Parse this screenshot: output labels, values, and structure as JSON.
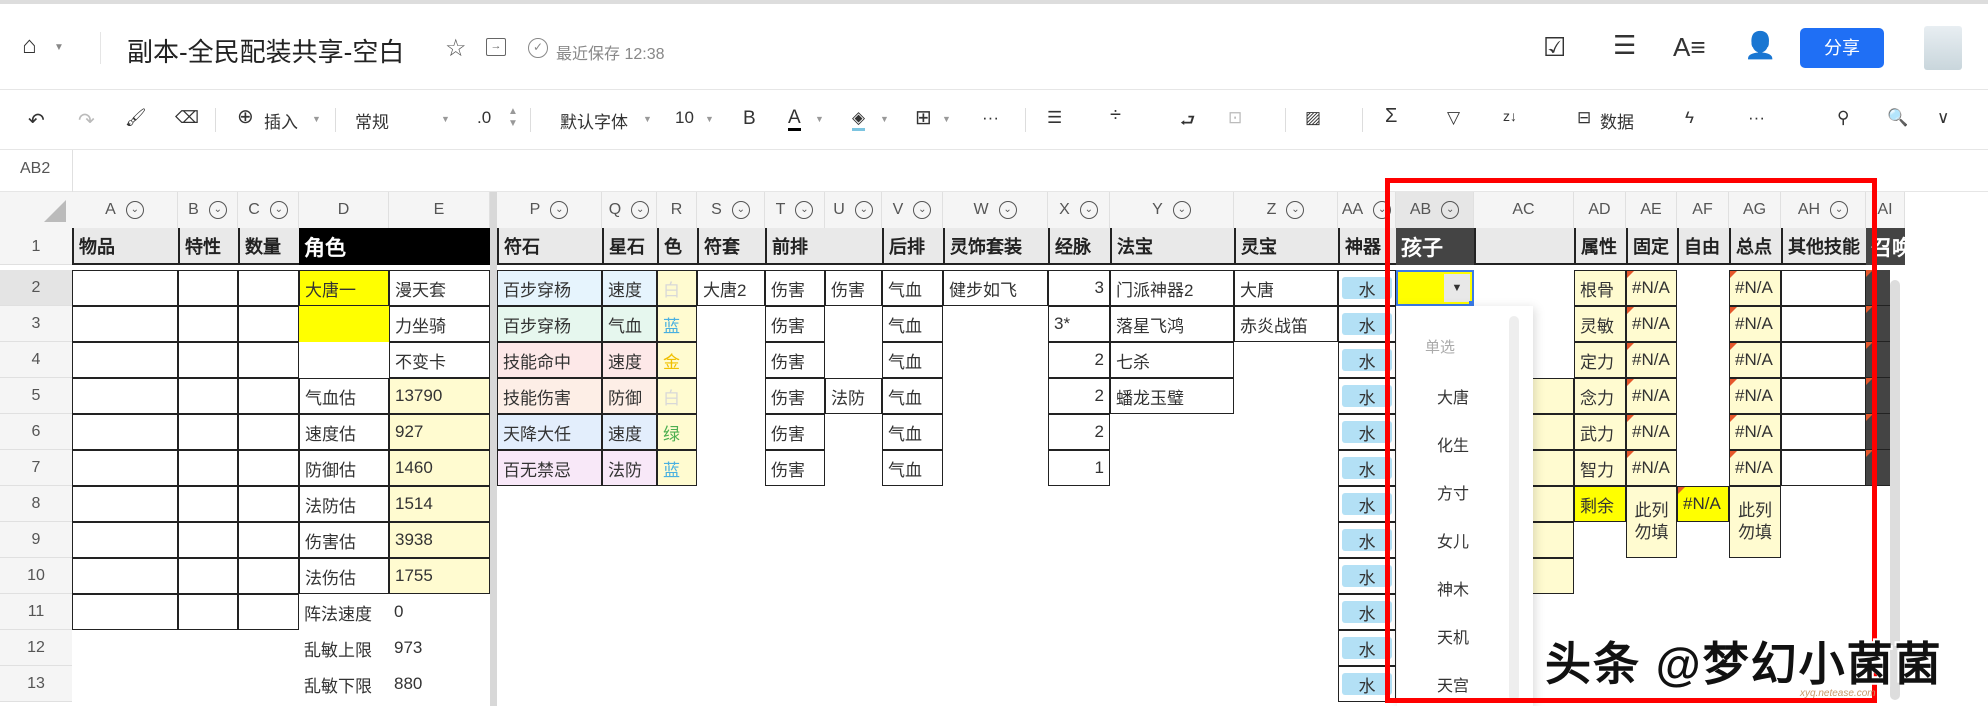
{
  "header": {
    "title": "副本-全民配装共享-空白",
    "save_status": "最近保存 12:38",
    "share": "分享"
  },
  "toolbar": {
    "insert": "插入",
    "format": "常规",
    "decimal": ".0",
    "font": "默认字体",
    "size": "10",
    "bold": "B",
    "font_color": "A",
    "data": "数据",
    "more": "···"
  },
  "formula_bar": {
    "cell_ref": "AB2"
  },
  "columns": [
    {
      "id": "A",
      "filter": true
    },
    {
      "id": "B",
      "filter": true
    },
    {
      "id": "C",
      "filter": true
    },
    {
      "id": "D"
    },
    {
      "id": "E"
    },
    {
      "id": "P",
      "filter": true
    },
    {
      "id": "Q",
      "filter": true
    },
    {
      "id": "R"
    },
    {
      "id": "S",
      "filter": true
    },
    {
      "id": "T",
      "filter": true
    },
    {
      "id": "U",
      "filter": true
    },
    {
      "id": "V",
      "filter": true
    },
    {
      "id": "W",
      "filter": true
    },
    {
      "id": "X",
      "filter": true
    },
    {
      "id": "Y",
      "filter": true
    },
    {
      "id": "Z",
      "filter": true
    },
    {
      "id": "AA",
      "filter": true
    },
    {
      "id": "AB",
      "filter": true
    },
    {
      "id": "AC"
    },
    {
      "id": "AD"
    },
    {
      "id": "AE"
    },
    {
      "id": "AF"
    },
    {
      "id": "AG"
    },
    {
      "id": "AH",
      "filter": true
    },
    {
      "id": "AI"
    }
  ],
  "rows": [
    "1",
    "2",
    "3",
    "4",
    "5",
    "6",
    "7",
    "8",
    "9",
    "10",
    "11",
    "12",
    "13"
  ],
  "colors": {
    "light_yellow": "#fffbd0",
    "yellow": "#ffff00",
    "chip": "#b3e0f5",
    "red": "#ff0000",
    "share": "#1f6ff5"
  },
  "cells": [
    {
      "c": "A",
      "r": 1,
      "t": "物品",
      "s": "hdr"
    },
    {
      "c": "B",
      "r": 1,
      "t": "特性",
      "s": "hdr"
    },
    {
      "c": "C",
      "r": 1,
      "t": "数量",
      "s": "hdr"
    },
    {
      "c": "D",
      "c2": "E",
      "r": 1,
      "t": "角色",
      "s": "hdrblack"
    },
    {
      "c": "P",
      "r": 1,
      "t": "符石",
      "s": "hdr"
    },
    {
      "c": "Q",
      "r": 1,
      "t": "星石",
      "s": "hdr"
    },
    {
      "c": "R",
      "r": 1,
      "t": "色",
      "s": "hdr"
    },
    {
      "c": "S",
      "r": 1,
      "t": "符套",
      "s": "hdr"
    },
    {
      "c": "T",
      "c2": "U",
      "r": 1,
      "t": "前排",
      "s": "hdr"
    },
    {
      "c": "V",
      "r": 1,
      "t": "后排",
      "s": "hdr"
    },
    {
      "c": "W",
      "r": 1,
      "t": "灵饰套装",
      "s": "hdr"
    },
    {
      "c": "X",
      "r": 1,
      "t": "经脉",
      "s": "hdr"
    },
    {
      "c": "Y",
      "r": 1,
      "t": "法宝",
      "s": "hdr"
    },
    {
      "c": "Z",
      "r": 1,
      "t": "灵宝",
      "s": "hdr"
    },
    {
      "c": "AA",
      "r": 1,
      "t": "神器",
      "s": "hdr"
    },
    {
      "c": "AB",
      "r": 1,
      "t": "孩子",
      "s": "hdrdark"
    },
    {
      "c": "AC",
      "r": 1,
      "t": "",
      "s": "hdr"
    },
    {
      "c": "AD",
      "r": 1,
      "t": "属性",
      "s": "hdr"
    },
    {
      "c": "AE",
      "r": 1,
      "t": "固定",
      "s": "hdr"
    },
    {
      "c": "AF",
      "r": 1,
      "t": "自由",
      "s": "hdr"
    },
    {
      "c": "AG",
      "r": 1,
      "t": "总点",
      "s": "hdr"
    },
    {
      "c": "AH",
      "r": 1,
      "t": "其他技能",
      "s": "hdr"
    },
    {
      "c": "AI",
      "r": 1,
      "t": "召唤",
      "s": "hdrdark"
    },
    {
      "c": "D",
      "r": 2,
      "t": "大唐一",
      "s": "b",
      "bg": "#ffff00"
    },
    {
      "c": "D",
      "r": 3,
      "t": "",
      "bg": "#ffff00"
    },
    {
      "c": "E",
      "r": 2,
      "t": "漫天套",
      "s": "b"
    },
    {
      "c": "E",
      "r": 3,
      "t": "力坐骑",
      "s": "b"
    },
    {
      "c": "E",
      "r": 4,
      "t": "不变卡",
      "s": "b"
    },
    {
      "c": "D",
      "r": 5,
      "t": "气血估",
      "s": "b"
    },
    {
      "c": "E",
      "r": 5,
      "t": "13790",
      "s": "b",
      "bg": "#fffbd0"
    },
    {
      "c": "D",
      "r": 6,
      "t": "速度估",
      "s": "b"
    },
    {
      "c": "E",
      "r": 6,
      "t": "927",
      "s": "b",
      "bg": "#fffbd0"
    },
    {
      "c": "D",
      "r": 7,
      "t": "防御估",
      "s": "b"
    },
    {
      "c": "E",
      "r": 7,
      "t": "1460",
      "s": "b",
      "bg": "#fffbd0"
    },
    {
      "c": "D",
      "r": 8,
      "t": "法防估",
      "s": "b"
    },
    {
      "c": "E",
      "r": 8,
      "t": "1514",
      "s": "b",
      "bg": "#fffbd0"
    },
    {
      "c": "D",
      "r": 9,
      "t": "伤害估",
      "s": "b"
    },
    {
      "c": "E",
      "r": 9,
      "t": "3938",
      "s": "b",
      "bg": "#fffbd0"
    },
    {
      "c": "D",
      "r": 10,
      "t": "法伤估",
      "s": "b"
    },
    {
      "c": "E",
      "r": 10,
      "t": "1755",
      "s": "b",
      "bg": "#fffbd0"
    },
    {
      "c": "D",
      "r": 11,
      "t": "阵法速度"
    },
    {
      "c": "E",
      "r": 11,
      "t": "0"
    },
    {
      "c": "D",
      "r": 12,
      "t": "乱敏上限"
    },
    {
      "c": "E",
      "r": 12,
      "t": "973"
    },
    {
      "c": "D",
      "r": 13,
      "t": "乱敏下限"
    },
    {
      "c": "E",
      "r": 13,
      "t": "880"
    },
    {
      "c": "P",
      "r": 2,
      "t": "百步穿杨",
      "s": "b",
      "bg": "#e6f4fd"
    },
    {
      "c": "Q",
      "r": 2,
      "t": "速度",
      "s": "b",
      "bg": "#e6f4fd"
    },
    {
      "c": "R",
      "r": 2,
      "t": "白",
      "s": "b",
      "bg": "#fffbd0",
      "fg": "#d8d8d8"
    },
    {
      "c": "P",
      "r": 3,
      "t": "百步穿杨",
      "s": "b",
      "bg": "#e6f7ee"
    },
    {
      "c": "Q",
      "r": 3,
      "t": "气血",
      "s": "b",
      "bg": "#e6f7ee"
    },
    {
      "c": "R",
      "r": 3,
      "t": "蓝",
      "s": "b",
      "bg": "#fffbd0",
      "fg": "#4ab0e0"
    },
    {
      "c": "P",
      "r": 4,
      "t": "技能命中",
      "s": "b",
      "bg": "#fde8e8"
    },
    {
      "c": "Q",
      "r": 4,
      "t": "速度",
      "s": "b",
      "bg": "#fde8e8"
    },
    {
      "c": "R",
      "r": 4,
      "t": "金",
      "s": "b",
      "bg": "#fffbd0",
      "fg": "#f0c000"
    },
    {
      "c": "P",
      "r": 5,
      "t": "技能伤害",
      "s": "b",
      "bg": "#fdeee6"
    },
    {
      "c": "Q",
      "r": 5,
      "t": "防御",
      "s": "b",
      "bg": "#fdeee6"
    },
    {
      "c": "R",
      "r": 5,
      "t": "白",
      "s": "b",
      "bg": "#fffbd0",
      "fg": "#d8d8d8"
    },
    {
      "c": "P",
      "r": 6,
      "t": "天降大任",
      "s": "b",
      "bg": "#e3eefc"
    },
    {
      "c": "Q",
      "r": 6,
      "t": "速度",
      "s": "b",
      "bg": "#e3eefc"
    },
    {
      "c": "R",
      "r": 6,
      "t": "绿",
      "s": "b",
      "bg": "#fffbd0",
      "fg": "#4caf50"
    },
    {
      "c": "P",
      "r": 7,
      "t": "百无禁忌",
      "s": "b",
      "bg": "#f8e8f8"
    },
    {
      "c": "Q",
      "r": 7,
      "t": "法防",
      "s": "b",
      "bg": "#f8e8f8"
    },
    {
      "c": "R",
      "r": 7,
      "t": "蓝",
      "s": "b",
      "bg": "#fffbd0",
      "fg": "#4ab0e0"
    },
    {
      "c": "S",
      "r": 2,
      "t": "大唐2",
      "s": "b"
    },
    {
      "c": "T",
      "r": 2,
      "t": "伤害",
      "s": "b"
    },
    {
      "c": "T",
      "r": 3,
      "t": "伤害",
      "s": "b"
    },
    {
      "c": "T",
      "r": 4,
      "t": "伤害",
      "s": "b"
    },
    {
      "c": "T",
      "r": 5,
      "t": "伤害",
      "s": "b"
    },
    {
      "c": "T",
      "r": 6,
      "t": "伤害",
      "s": "b"
    },
    {
      "c": "T",
      "r": 7,
      "t": "伤害",
      "s": "b"
    },
    {
      "c": "U",
      "r": 2,
      "t": "伤害",
      "s": "b"
    },
    {
      "c": "U",
      "r": 5,
      "t": "法防",
      "s": "b"
    },
    {
      "c": "V",
      "r": 2,
      "t": "气血",
      "s": "b"
    },
    {
      "c": "V",
      "r": 3,
      "t": "气血",
      "s": "b"
    },
    {
      "c": "V",
      "r": 4,
      "t": "气血",
      "s": "b"
    },
    {
      "c": "V",
      "r": 5,
      "t": "气血",
      "s": "b"
    },
    {
      "c": "V",
      "r": 6,
      "t": "气血",
      "s": "b"
    },
    {
      "c": "V",
      "r": 7,
      "t": "气血",
      "s": "b"
    },
    {
      "c": "W",
      "r": 2,
      "t": "健步如飞",
      "s": "b"
    },
    {
      "c": "X",
      "r": 2,
      "t": "3",
      "s": "b r"
    },
    {
      "c": "X",
      "r": 3,
      "t": "3*",
      "s": "b"
    },
    {
      "c": "X",
      "r": 4,
      "t": "2",
      "s": "b r"
    },
    {
      "c": "X",
      "r": 5,
      "t": "2",
      "s": "b r"
    },
    {
      "c": "X",
      "r": 6,
      "t": "2",
      "s": "b r"
    },
    {
      "c": "X",
      "r": 7,
      "t": "1",
      "s": "b r"
    },
    {
      "c": "Y",
      "r": 2,
      "t": "门派神器2",
      "s": "b"
    },
    {
      "c": "Y",
      "r": 3,
      "t": "落星飞鸿",
      "s": "b"
    },
    {
      "c": "Y",
      "r": 4,
      "t": "七杀",
      "s": "b"
    },
    {
      "c": "Y",
      "r": 5,
      "t": "蟠龙玉璧",
      "s": "b"
    },
    {
      "c": "Z",
      "r": 2,
      "t": "大唐",
      "s": "b"
    },
    {
      "c": "Z",
      "r": 3,
      "t": "赤炎战笛",
      "s": "b"
    },
    {
      "c": "AC",
      "r": 5,
      "t": "",
      "s": "b",
      "bg": "#fffbd0"
    },
    {
      "c": "AC",
      "r": 6,
      "t": "",
      "s": "b",
      "bg": "#fffbd0"
    },
    {
      "c": "AC",
      "r": 7,
      "t": "",
      "s": "b",
      "bg": "#fffbd0"
    },
    {
      "c": "AC",
      "r": 8,
      "t": "",
      "s": "b",
      "bg": "#fffbd0"
    },
    {
      "c": "AC",
      "r": 9,
      "t": "",
      "s": "b",
      "bg": "#fffbd0"
    },
    {
      "c": "AC",
      "r": 10,
      "t": "",
      "s": "b",
      "bg": "#fffbd0"
    },
    {
      "c": "AD",
      "r": 2,
      "t": "根骨",
      "s": "b",
      "bg": "#fffbd0"
    },
    {
      "c": "AD",
      "r": 3,
      "t": "灵敏",
      "s": "b",
      "bg": "#fffbd0"
    },
    {
      "c": "AD",
      "r": 4,
      "t": "定力",
      "s": "b",
      "bg": "#fffbd0"
    },
    {
      "c": "AD",
      "r": 5,
      "t": "念力",
      "s": "b",
      "bg": "#fffbd0"
    },
    {
      "c": "AD",
      "r": 6,
      "t": "武力",
      "s": "b",
      "bg": "#fffbd0"
    },
    {
      "c": "AD",
      "r": 7,
      "t": "智力",
      "s": "b",
      "bg": "#fffbd0"
    },
    {
      "c": "AD",
      "r": 8,
      "t": "剩余",
      "s": "b",
      "bg": "#ffff00"
    },
    {
      "c": "AE",
      "r": 2,
      "t": "#N/A",
      "s": "b",
      "bg": "#fffbd0",
      "err": true
    },
    {
      "c": "AE",
      "r": 3,
      "t": "#N/A",
      "s": "b",
      "bg": "#fffbd0",
      "err": true
    },
    {
      "c": "AE",
      "r": 4,
      "t": "#N/A",
      "s": "b",
      "bg": "#fffbd0",
      "err": true
    },
    {
      "c": "AE",
      "r": 5,
      "t": "#N/A",
      "s": "b",
      "bg": "#fffbd0",
      "err": true
    },
    {
      "c": "AE",
      "r": 6,
      "t": "#N/A",
      "s": "b",
      "bg": "#fffbd0",
      "err": true
    },
    {
      "c": "AE",
      "r": 7,
      "t": "#N/A",
      "s": "b",
      "bg": "#fffbd0",
      "err": true
    },
    {
      "c": "AE",
      "r": 8,
      "r2": 9,
      "t": "此列勿填",
      "s": "b wrap c",
      "bg": "#fffbd0"
    },
    {
      "c": "AF",
      "r": 8,
      "t": "#N/A",
      "s": "b",
      "bg": "#ffff00",
      "err": true
    },
    {
      "c": "AG",
      "r": 2,
      "t": "#N/A",
      "s": "b",
      "bg": "#fffbd0",
      "err": true
    },
    {
      "c": "AG",
      "r": 3,
      "t": "#N/A",
      "s": "b",
      "bg": "#fffbd0",
      "err": true
    },
    {
      "c": "AG",
      "r": 4,
      "t": "#N/A",
      "s": "b",
      "bg": "#fffbd0",
      "err": true
    },
    {
      "c": "AG",
      "r": 5,
      "t": "#N/A",
      "s": "b",
      "bg": "#fffbd0",
      "err": true
    },
    {
      "c": "AG",
      "r": 6,
      "t": "#N/A",
      "s": "b",
      "bg": "#fffbd0",
      "err": true
    },
    {
      "c": "AG",
      "r": 7,
      "t": "#N/A",
      "s": "b",
      "bg": "#fffbd0",
      "err": true
    },
    {
      "c": "AG",
      "r": 8,
      "r2": 9,
      "t": "此列勿填",
      "s": "b wrap c",
      "bg": "#fffbd0"
    },
    {
      "c": "AH",
      "r": 2,
      "t": "",
      "s": "b"
    },
    {
      "c": "AH",
      "r": 3,
      "t": "",
      "s": "b"
    },
    {
      "c": "AH",
      "r": 4,
      "t": "",
      "s": "b"
    },
    {
      "c": "AH",
      "r": 5,
      "t": "",
      "s": "b"
    },
    {
      "c": "AH",
      "r": 6,
      "t": "",
      "s": "b"
    },
    {
      "c": "AH",
      "r": 7,
      "t": "",
      "s": "b"
    }
  ],
  "artifact_value": "水",
  "dropdown": {
    "section": "单选",
    "options": [
      "大唐",
      "化生",
      "方寸",
      "女儿",
      "神木",
      "天机",
      "天宫"
    ]
  },
  "watermark": {
    "text": "头条 @梦幻小菌菌",
    "logo": "xyq.netease.com"
  }
}
